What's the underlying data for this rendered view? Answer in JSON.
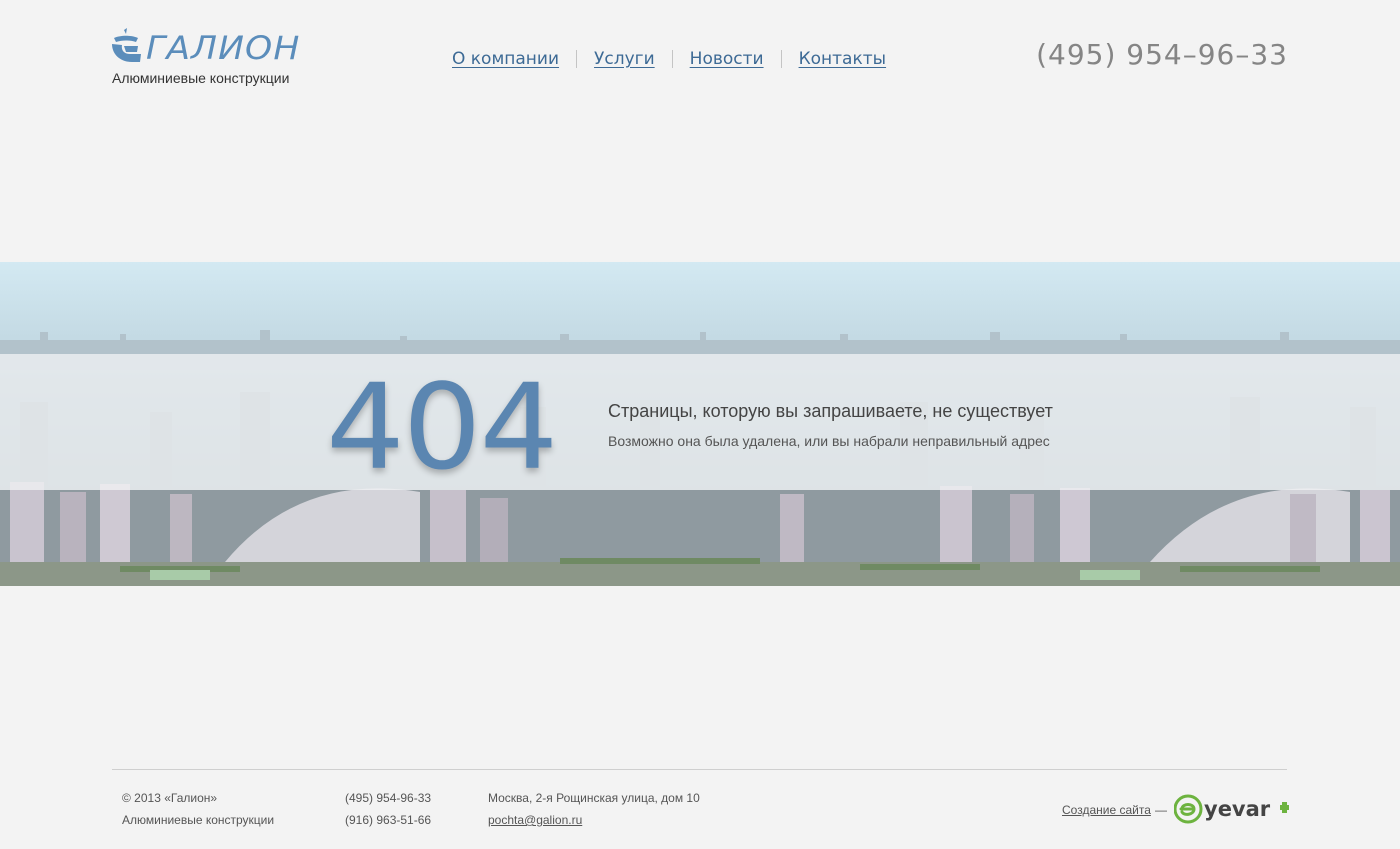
{
  "header": {
    "logo_text": "ГАЛИОН",
    "tagline": "Алюминиевые конструкции",
    "phone": "(495) 954–96–33"
  },
  "nav": {
    "items": [
      {
        "label": "О компании"
      },
      {
        "label": "Услуги"
      },
      {
        "label": "Новости"
      },
      {
        "label": "Контакты"
      }
    ]
  },
  "error": {
    "code": "404",
    "title": "Страницы, которую вы запрашиваете, не существует",
    "subtitle": "Возможно она была удалена, или вы набрали неправильный адрес"
  },
  "footer": {
    "copyright": "© 2013  «Галион»",
    "tagline": "Алюминиевые конструкции",
    "phone1": "(495) 954-96-33",
    "phone2": "(916) 963-51-66",
    "address": "Москва, 2-я Рощинская улица, дом 10",
    "email": "pochta@galion.ru",
    "dev_link": "Создание сайта",
    "dev_dash": "—",
    "dev_brand": "yevar"
  },
  "colors": {
    "accent": "#5b8dbb",
    "nav_link": "#3d6a95",
    "background": "#f3f3f3",
    "dev_brand_green": "#6db33f"
  },
  "icons": {
    "logo": "ship-sail-icon",
    "dev": "eyevar-logo-icon"
  }
}
